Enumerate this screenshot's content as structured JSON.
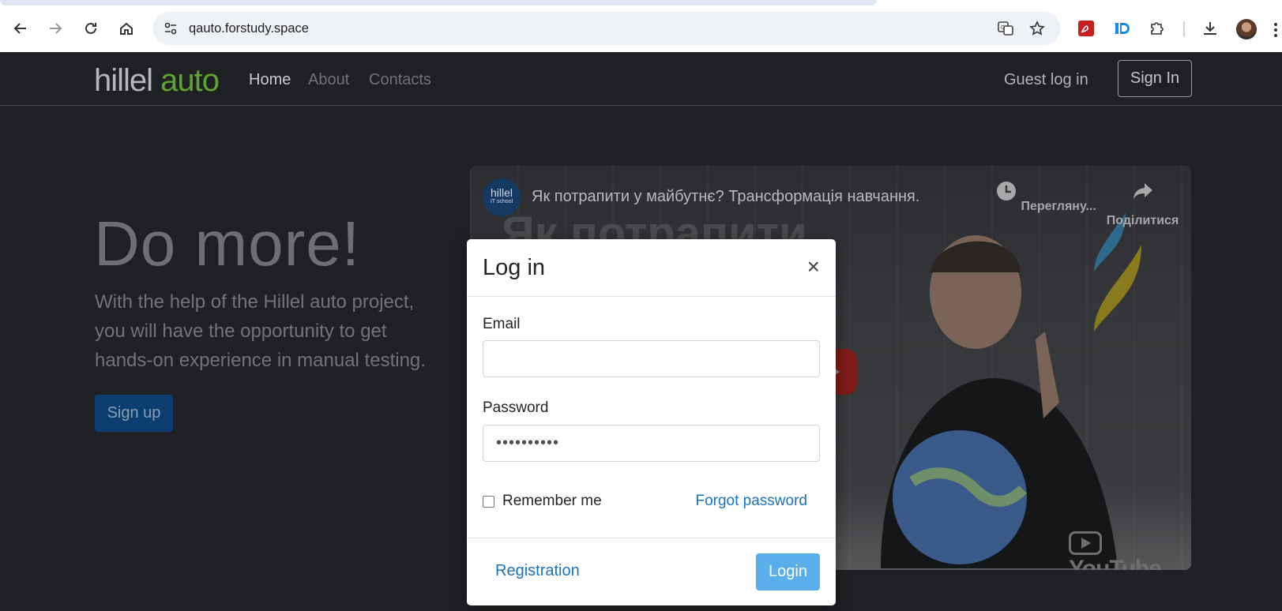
{
  "browser": {
    "url": "qauto.forstudy.space"
  },
  "header": {
    "logo_part1": "hillel",
    "logo_part2": "auto",
    "nav": [
      {
        "label": "Home"
      },
      {
        "label": "About"
      },
      {
        "label": "Contacts"
      }
    ],
    "guest_login": "Guest log in",
    "sign_in": "Sign In"
  },
  "hero": {
    "title": "Do more!",
    "text": "With the help of the Hillel auto project, you will have the opportunity to get hands-on experience in manual testing.",
    "signup": "Sign up"
  },
  "video": {
    "channel_name": "hillel",
    "channel_sub": "IT school",
    "title": "Як потрапити у майбутнє? Трансформація навчання.",
    "big_text": "Як потрапити",
    "watch_later": "Перегляну...",
    "share": "Поділитися",
    "platform": "YouTube"
  },
  "modal": {
    "title": "Log in",
    "close": "×",
    "email_label": "Email",
    "email_value": "",
    "password_label": "Password",
    "password_value": "••••••••••",
    "remember_label": "Remember me",
    "forgot": "Forgot password",
    "registration": "Registration",
    "login": "Login"
  },
  "colors": {
    "accent": "#5aaeea",
    "link": "#1a73b8",
    "brand_green": "#5ea530",
    "page_bg": "#1f2023"
  }
}
